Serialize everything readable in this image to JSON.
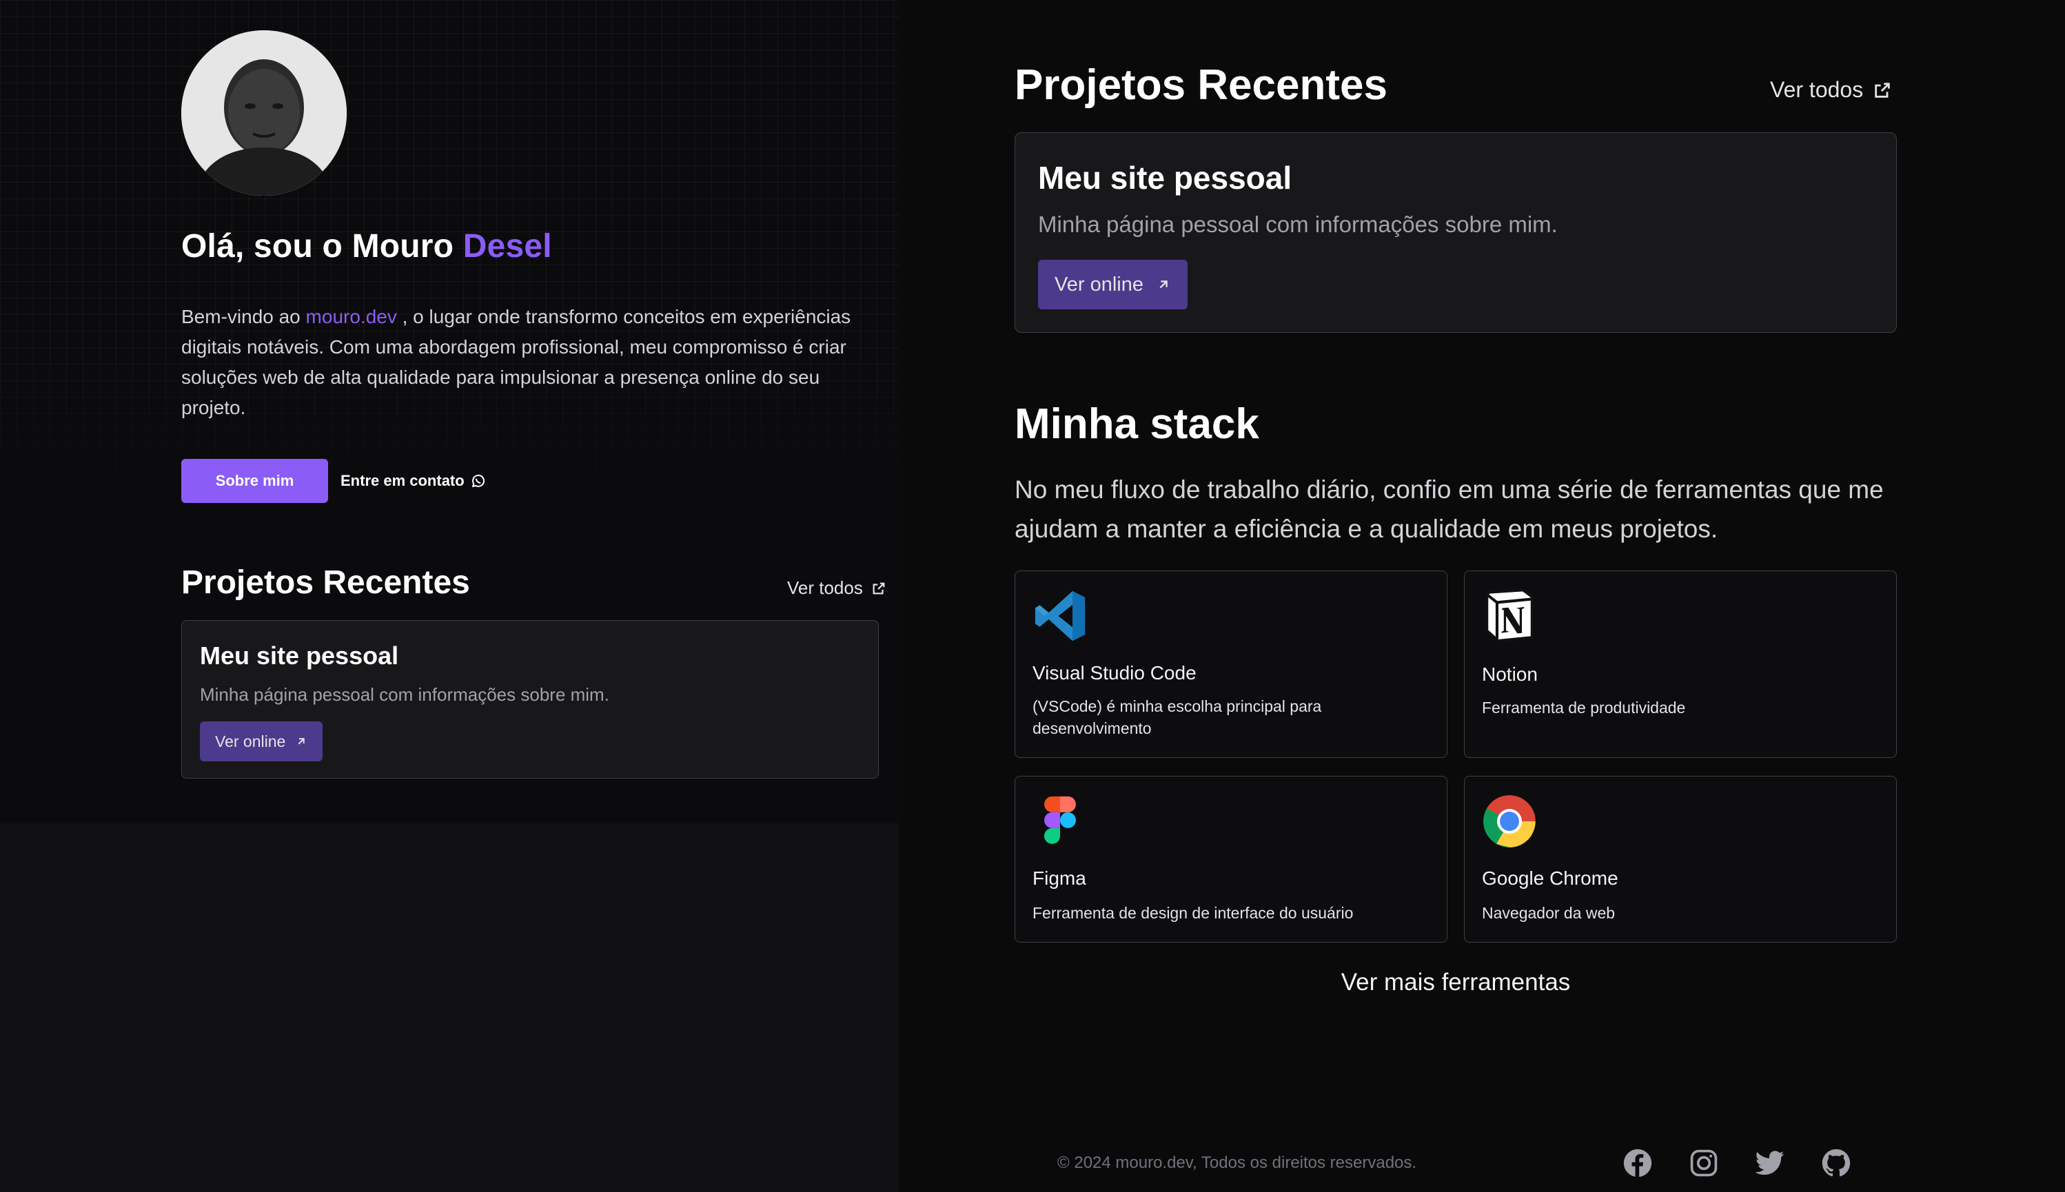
{
  "hero": {
    "greeting_prefix": "Olá, sou o Mouro ",
    "greeting_accent": "Desel",
    "intro_prefix": "Bem-vindo ao ",
    "intro_link": "mouro.dev",
    "intro_suffix": " , o lugar onde transformo conceitos em experiências digitais notáveis. Com uma abordagem profissional, meu compromisso é criar soluções web de alta qualidade para impulsionar a presença online do seu projeto.",
    "about_button": "Sobre mim",
    "contact_button": "Entre em contato"
  },
  "recent_projects": {
    "title": "Projetos Recentes",
    "see_all": "Ver todos",
    "projects": [
      {
        "title": "Meu site pessoal",
        "description": "Minha página pessoal com informações sobre mim.",
        "button": "Ver online"
      }
    ]
  },
  "stack": {
    "title": "Minha stack",
    "description": "No meu fluxo de trabalho diário, confio em uma série de ferramentas que me ajudam a manter a eficiência e a qualidade em meus projetos.",
    "tools": [
      {
        "name": "Visual Studio Code",
        "description": "(VSCode) é minha escolha principal para desenvolvimento",
        "icon": "vscode-icon"
      },
      {
        "name": "Notion",
        "description": "Ferramenta de produtividade",
        "icon": "notion-icon"
      },
      {
        "name": "Figma",
        "description": "Ferramenta de design de interface do usuário",
        "icon": "figma-icon"
      },
      {
        "name": "Google Chrome",
        "description": "Navegador da web",
        "icon": "chrome-icon"
      }
    ],
    "more": "Ver mais ferramentas"
  },
  "footer": {
    "copyright": "© 2024 mouro.dev, Todos os direitos reservados.",
    "social": [
      "facebook-icon",
      "instagram-icon",
      "twitter-icon",
      "github-icon"
    ]
  },
  "colors": {
    "accent": "#8b5cf6",
    "button_dark": "#4c3a8c",
    "background": "#0a0a0b"
  }
}
